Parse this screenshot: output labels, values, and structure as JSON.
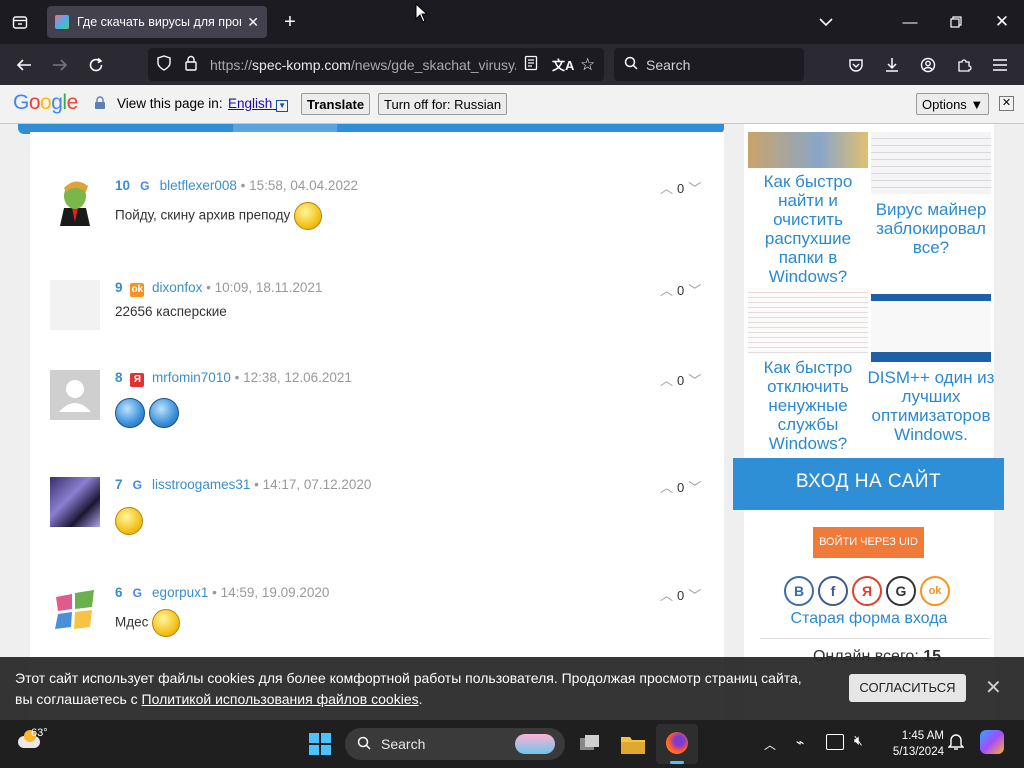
{
  "browser": {
    "tab_title": "Где скачать вирусы для прове",
    "url_prefix": "https://",
    "url_host": "spec-komp.com",
    "url_path": "/news/gde_skachat_virusy/",
    "search_placeholder": "Search"
  },
  "translate_bar": {
    "logo": "Google",
    "view_label": "View this page in:",
    "language": "English",
    "translate_label": "Translate",
    "turn_off_label": "Turn off for: Russian",
    "options_label": "Options ▼",
    "close_label": "✕"
  },
  "comments": [
    {
      "num": "10",
      "source": "G",
      "user": "bletflexer008",
      "meta": "• 15:58, 04.04.2022",
      "text": "Пойду, скину архив преподу",
      "votes": "0"
    },
    {
      "num": "9",
      "source": "ok",
      "user": "dixonfox",
      "meta": "• 10:09, 18.11.2021",
      "text": "22656 касперские",
      "votes": "0"
    },
    {
      "num": "8",
      "source": "Я",
      "user": "mrfomin7010",
      "meta": "• 12:38, 12.06.2021",
      "text": "",
      "votes": "0"
    },
    {
      "num": "7",
      "source": "G",
      "user": "lisstroogames31",
      "meta": "• 14:17, 07.12.2020",
      "text": "",
      "votes": "0"
    },
    {
      "num": "6",
      "source": "G",
      "user": "egorpux1",
      "meta": "• 14:59, 19.09.2020",
      "text": "Мдес",
      "votes": "0"
    }
  ],
  "sidebar": {
    "link1": "Как быстро найти и очистить распухшие папки в Windows?",
    "link2": "Вирус майнер заблокировал все?",
    "link3": "Как быстро отключить ненужные службы Windows?",
    "link4": "DISM++ один из лучших оптимизаторов Windows.",
    "login_header": "ВХОД НА САЙТ",
    "uid_button": "ВОЙТИ ЧЕРЕЗ UID",
    "social": [
      "B",
      "f",
      "Я",
      "G",
      "ok"
    ],
    "old_login": "Старая форма входа",
    "online_label": "Онлайн всего:",
    "online_count": "15"
  },
  "cookie": {
    "line1": "Этот сайт использует файлы cookies для более комфортной работы пользователя. Продолжая просмотр страниц сайта,",
    "line2_prefix": "вы соглашаетесь с ",
    "line2_link": "Политикой использования файлов cookies",
    "line2_suffix": ".",
    "agree": "СОГЛАСИТЬСЯ",
    "close": "✕"
  },
  "taskbar": {
    "weather_temp": "63°",
    "search_label": "Search",
    "time": "1:45 AM",
    "date": "5/13/2024"
  },
  "colors": {
    "accent": "#2e8fd6",
    "link": "#3a8fc9",
    "uid_button": "#f07a3a"
  }
}
